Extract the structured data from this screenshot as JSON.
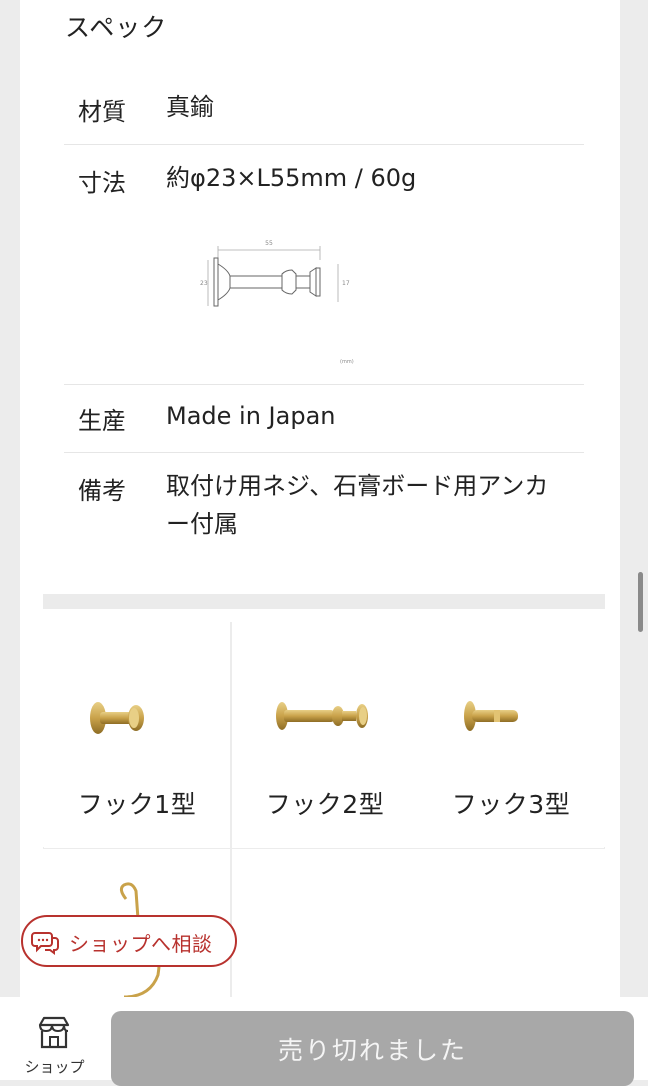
{
  "spec": {
    "title": "スペック",
    "rows": [
      {
        "key": "材質",
        "value": "真鍮"
      },
      {
        "key": "寸法",
        "value": "約φ23×L55mm / 60g"
      },
      {
        "key": "生産",
        "value": "Made in Japan"
      },
      {
        "key": "備考",
        "value": "取付け用ネジ、石膏ボード用アンカー付属"
      }
    ],
    "diagram": {
      "length_label": "55",
      "left_label": "23",
      "right_label": "17",
      "unit_label": "(mm)"
    }
  },
  "related_products": [
    {
      "label": "フック1型",
      "icon": "brass-hook-type1"
    },
    {
      "label": "フック2型",
      "icon": "brass-hook-type2"
    },
    {
      "label": "フック3型",
      "icon": "brass-hook-type3"
    },
    {
      "label": "",
      "icon": "brass-ring-hook"
    }
  ],
  "consult_button": {
    "label": "ショップへ相談",
    "icon": "chat-bubbles-icon"
  },
  "bottom_bar": {
    "shop_tab_label": "ショップ",
    "shop_icon": "storefront-icon",
    "soldout_label": "売り切れました"
  },
  "colors": {
    "accent_red": "#b8322e",
    "soldout_gray": "#a8a8a8",
    "brass": "#c9a24a"
  }
}
